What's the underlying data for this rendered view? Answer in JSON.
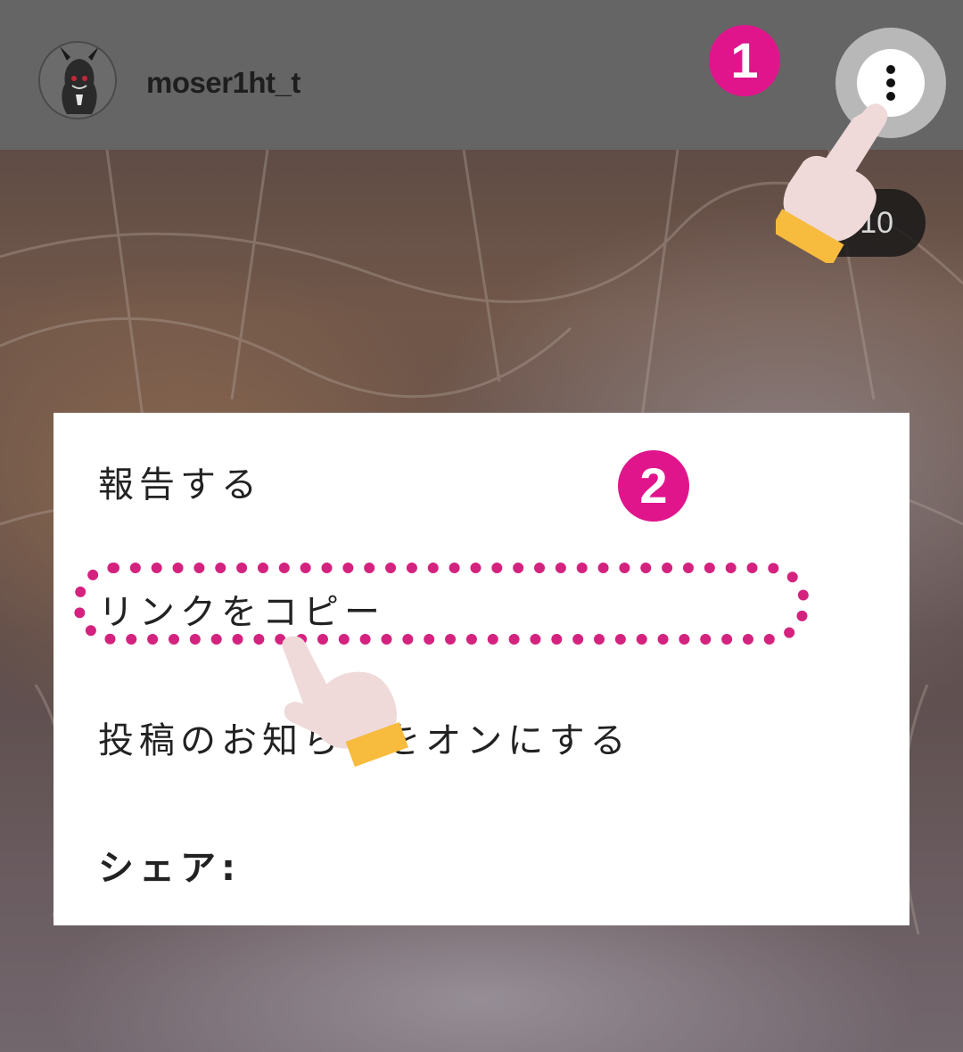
{
  "header": {
    "username": "moser1ht_t",
    "more_icon": "more-vertical-icon"
  },
  "steps": {
    "step1": "1",
    "step2": "2"
  },
  "counter": "1/10",
  "menu": {
    "items": [
      {
        "label": "報告する"
      },
      {
        "label": "リンクをコピー"
      },
      {
        "label": "投稿のお知らせをオンにする"
      },
      {
        "label": "シェア:"
      }
    ]
  },
  "colors": {
    "header_bg": "#656565",
    "badge": "#e0158c",
    "highlight": "#d4227f",
    "cuff": "#f7bb3e",
    "skin": "#efd9d9"
  }
}
